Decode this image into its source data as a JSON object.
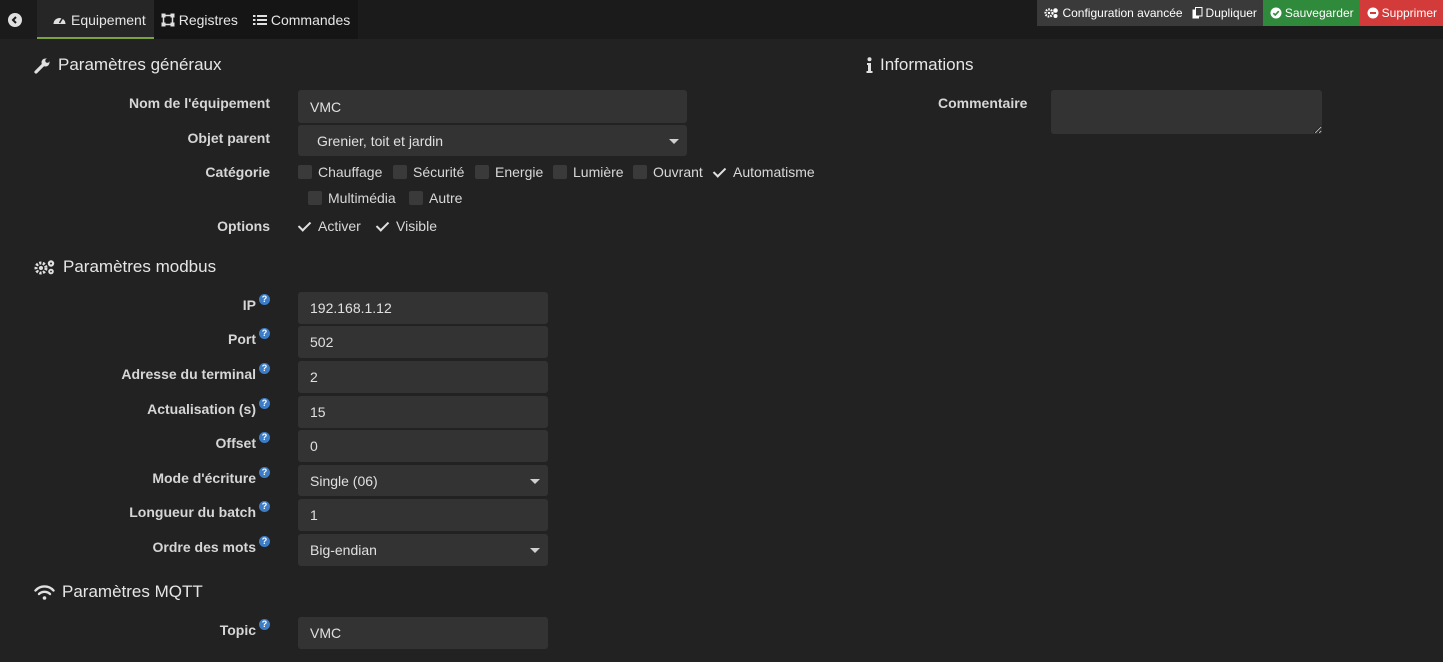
{
  "tabs": [
    {
      "label": "Equipement",
      "icon": "dashboard-icon",
      "active": true
    },
    {
      "label": "Registres",
      "icon": "registers-icon",
      "active": false
    },
    {
      "label": "Commandes",
      "icon": "list-icon",
      "active": false
    }
  ],
  "actions": {
    "config": "Configuration avancée",
    "duplicate": "Dupliquer",
    "save": "Sauvegarder",
    "delete": "Supprimer"
  },
  "colors": {
    "accent_tab": "#7aa340",
    "save": "#2f8a3b",
    "delete": "#d33b3b",
    "help": "#3d7dc8"
  },
  "general": {
    "title": "Paramètres généraux",
    "name_label": "Nom de l'équipement",
    "name_value": "VMC",
    "parent_label": "Objet parent",
    "parent_value": "Grenier, toit et jardin",
    "category_label": "Catégorie",
    "categories": [
      {
        "label": "Chauffage",
        "checked": false
      },
      {
        "label": "Sécurité",
        "checked": false
      },
      {
        "label": "Energie",
        "checked": false
      },
      {
        "label": "Lumière",
        "checked": false
      },
      {
        "label": "Ouvrant",
        "checked": false
      },
      {
        "label": "Automatisme",
        "checked": true
      },
      {
        "label": "Multimédia",
        "checked": false
      },
      {
        "label": "Autre",
        "checked": false
      }
    ],
    "options_label": "Options",
    "options": [
      {
        "label": "Activer",
        "checked": true
      },
      {
        "label": "Visible",
        "checked": true
      }
    ]
  },
  "info": {
    "title": "Informations",
    "comment_label": "Commentaire",
    "comment_value": ""
  },
  "modbus": {
    "title": "Paramètres modbus",
    "ip_label": "IP",
    "ip_value": "192.168.1.12",
    "port_label": "Port",
    "port_value": "502",
    "terminal_label": "Adresse du terminal",
    "terminal_value": "2",
    "refresh_label": "Actualisation (s)",
    "refresh_value": "15",
    "offset_label": "Offset",
    "offset_value": "0",
    "write_label": "Mode d'écriture",
    "write_value": "Single (06)",
    "batch_label": "Longueur du batch",
    "batch_value": "1",
    "order_label": "Ordre des mots",
    "order_value": "Big-endian",
    "help": "?"
  },
  "mqtt": {
    "title": "Paramètres MQTT",
    "topic_label": "Topic",
    "topic_value": "VMC"
  }
}
